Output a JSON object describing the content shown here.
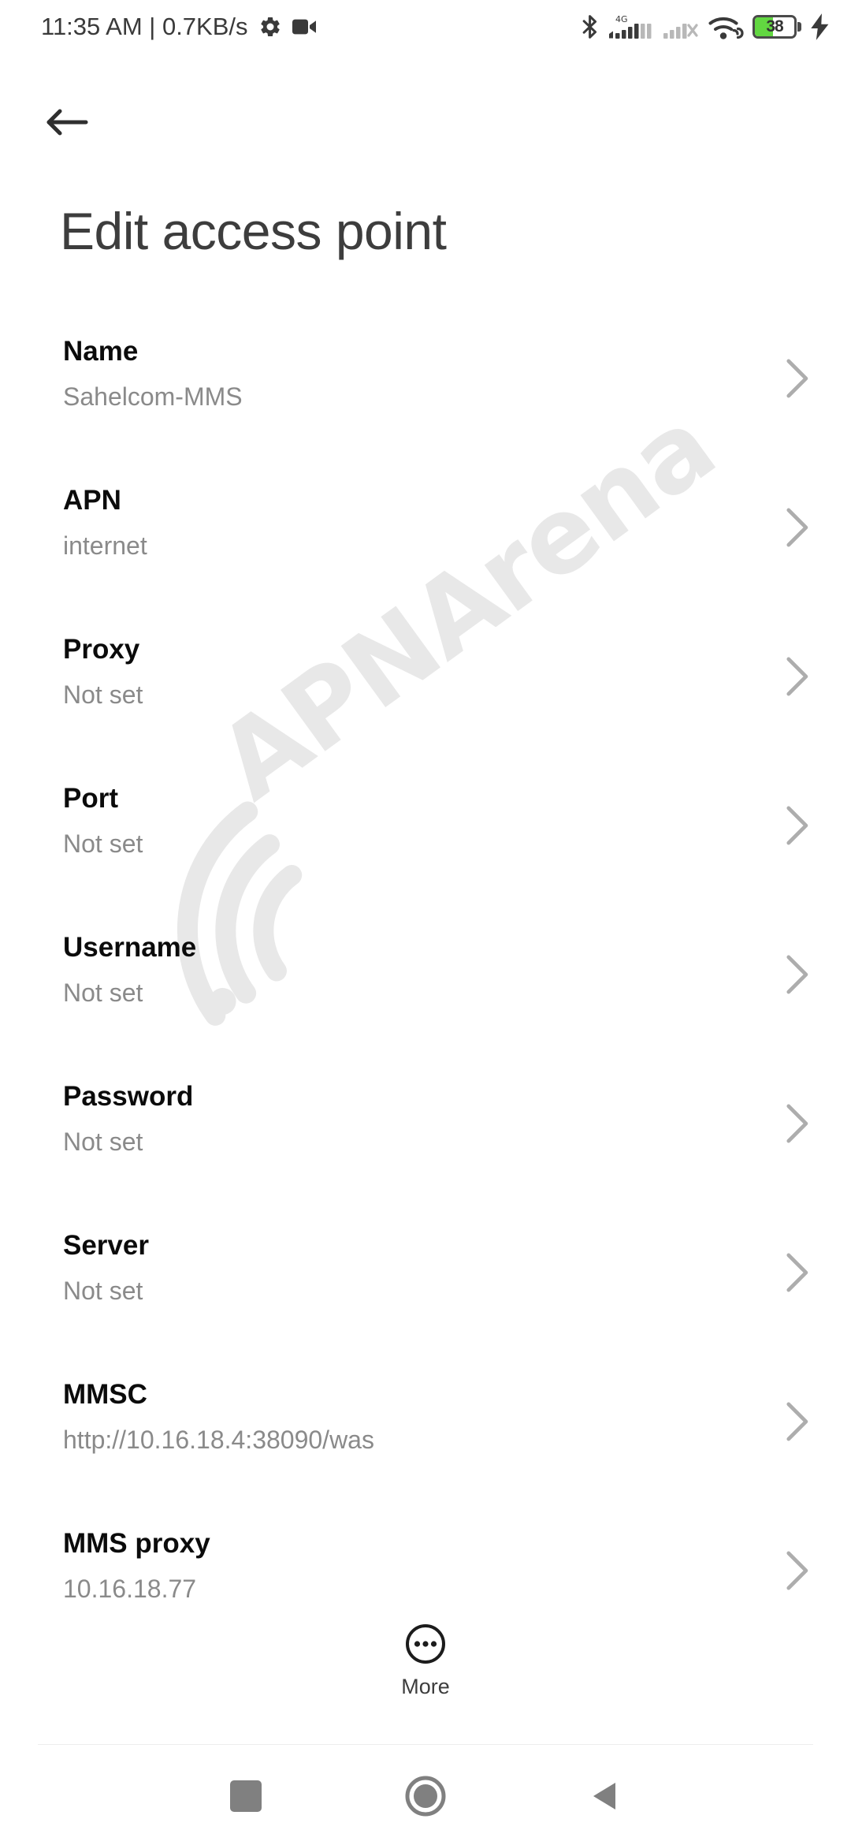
{
  "status_bar": {
    "clock_and_speed": "11:35 AM | 0.7KB/s",
    "icons_left": [
      "gear-icon",
      "video-camera-icon"
    ],
    "icons_right": [
      "bluetooth-icon",
      "signal-4g-icon",
      "signal-no-service-icon",
      "wifi-icon",
      "battery-icon",
      "charging-bolt-icon"
    ],
    "network_label": "4G",
    "battery_percent": "38",
    "battery_fill_color": "#62d741"
  },
  "header": {
    "back_icon": "arrow-left-icon",
    "title": "Edit access point"
  },
  "settings": {
    "rows": [
      {
        "label": "Name",
        "value": "Sahelcom-MMS"
      },
      {
        "label": "APN",
        "value": "internet"
      },
      {
        "label": "Proxy",
        "value": "Not set"
      },
      {
        "label": "Port",
        "value": "Not set"
      },
      {
        "label": "Username",
        "value": "Not set"
      },
      {
        "label": "Password",
        "value": "Not set"
      },
      {
        "label": "Server",
        "value": "Not set"
      },
      {
        "label": "MMSC",
        "value": "http://10.16.18.4:38090/was"
      },
      {
        "label": "MMS proxy",
        "value": "10.16.18.77"
      }
    ]
  },
  "more_button": {
    "label": "More",
    "icon": "more-horizontal-circle-icon"
  },
  "watermark": {
    "text": "APNArena",
    "color": "#e8e8e8"
  },
  "navigation_bar": {
    "recents_icon": "square-icon",
    "home_icon": "circle-icon",
    "back_icon": "triangle-left-icon",
    "color": "#808080"
  }
}
